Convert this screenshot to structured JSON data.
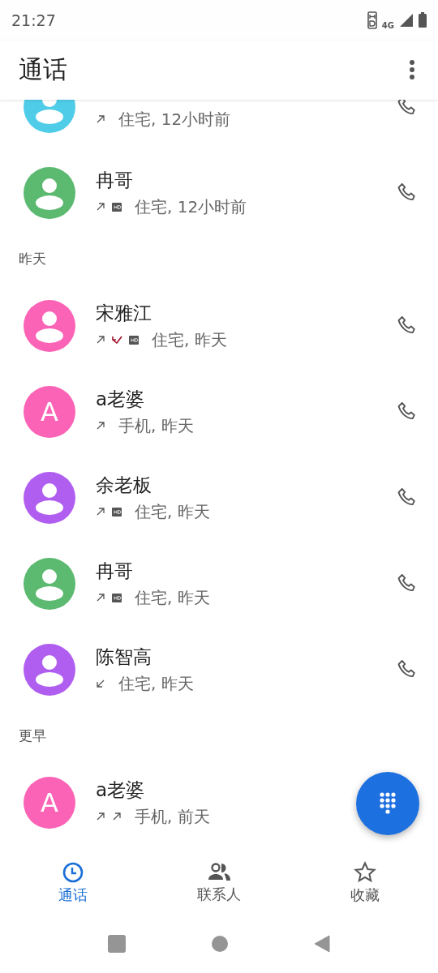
{
  "status_bar": {
    "time": "21:27",
    "network": "4G"
  },
  "app_bar": {
    "title": "通话"
  },
  "call_log": [
    {
      "kind": "call",
      "detail": "住宅, 12小时前",
      "avatar": {
        "kind": "silhouette",
        "color": "#4fcde8"
      },
      "indicators": [
        {
          "kind": "outgoing"
        }
      ]
    },
    {
      "kind": "call",
      "name": "冉哥",
      "detail": "住宅, 12小时前",
      "avatar": {
        "kind": "silhouette",
        "color": "#5cb970"
      },
      "indicators": [
        {
          "kind": "outgoing"
        },
        {
          "kind": "hd"
        }
      ]
    },
    {
      "kind": "header",
      "label": "昨天"
    },
    {
      "kind": "call",
      "name": "宋雅江",
      "detail": "住宅, 昨天",
      "avatar": {
        "kind": "silhouette",
        "color": "#fb64b6"
      },
      "indicators": [
        {
          "kind": "outgoing"
        },
        {
          "kind": "missed"
        },
        {
          "kind": "hd"
        }
      ]
    },
    {
      "kind": "call",
      "name": "a老婆",
      "detail": "手机, 昨天",
      "avatar": {
        "kind": "letter",
        "letter": "A",
        "color": "#fb64b6"
      },
      "indicators": [
        {
          "kind": "outgoing"
        }
      ]
    },
    {
      "kind": "call",
      "name": "余老板",
      "detail": "住宅, 昨天",
      "avatar": {
        "kind": "silhouette",
        "color": "#b05ef0"
      },
      "indicators": [
        {
          "kind": "outgoing"
        },
        {
          "kind": "hd"
        }
      ]
    },
    {
      "kind": "call",
      "name": "冉哥",
      "detail": "住宅, 昨天",
      "avatar": {
        "kind": "silhouette",
        "color": "#5cb970"
      },
      "indicators": [
        {
          "kind": "outgoing"
        },
        {
          "kind": "hd"
        }
      ]
    },
    {
      "kind": "call",
      "name": "陈智高",
      "detail": "住宅, 昨天",
      "avatar": {
        "kind": "silhouette",
        "color": "#b05ef0"
      },
      "indicators": [
        {
          "kind": "incoming"
        }
      ]
    },
    {
      "kind": "header",
      "label": "更早"
    },
    {
      "kind": "call",
      "name": "a老婆",
      "detail": "手机, 前天",
      "avatar": {
        "kind": "letter",
        "letter": "A",
        "color": "#fb64b6"
      },
      "indicators": [
        {
          "kind": "outgoing"
        },
        {
          "kind": "outgoing"
        }
      ],
      "call_icon_visible": false
    }
  ],
  "bottom_nav": [
    {
      "label": "通话",
      "selected": true
    },
    {
      "label": "联系人",
      "selected": false
    },
    {
      "label": "收藏",
      "selected": false
    }
  ]
}
